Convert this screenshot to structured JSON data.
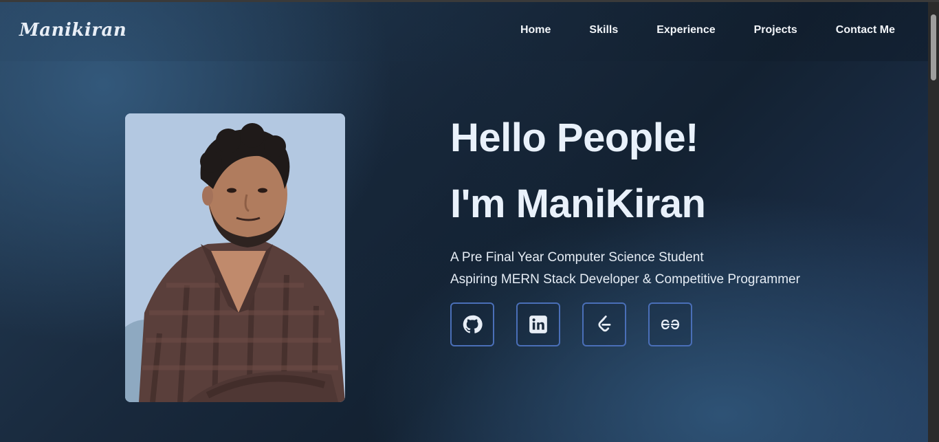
{
  "brand": {
    "logo": "Manikiran"
  },
  "nav": {
    "items": [
      {
        "label": "Home"
      },
      {
        "label": "Skills"
      },
      {
        "label": "Experience"
      },
      {
        "label": "Projects"
      },
      {
        "label": "Contact Me"
      }
    ]
  },
  "hero": {
    "greeting": "Hello People!",
    "intro": "I'm ManiKiran",
    "subtitle_1": "A Pre Final Year Computer Science Student",
    "subtitle_2": "Aspiring MERN Stack Developer & Competitive Programmer"
  },
  "socials": [
    {
      "icon": "github-icon"
    },
    {
      "icon": "linkedin-icon"
    },
    {
      "icon": "leetcode-icon"
    },
    {
      "icon": "geeksforgeeks-icon"
    }
  ],
  "colors": {
    "accent_border": "#4a6fb8",
    "heading": "#e9f1fb",
    "background": "#1a2a3d"
  }
}
